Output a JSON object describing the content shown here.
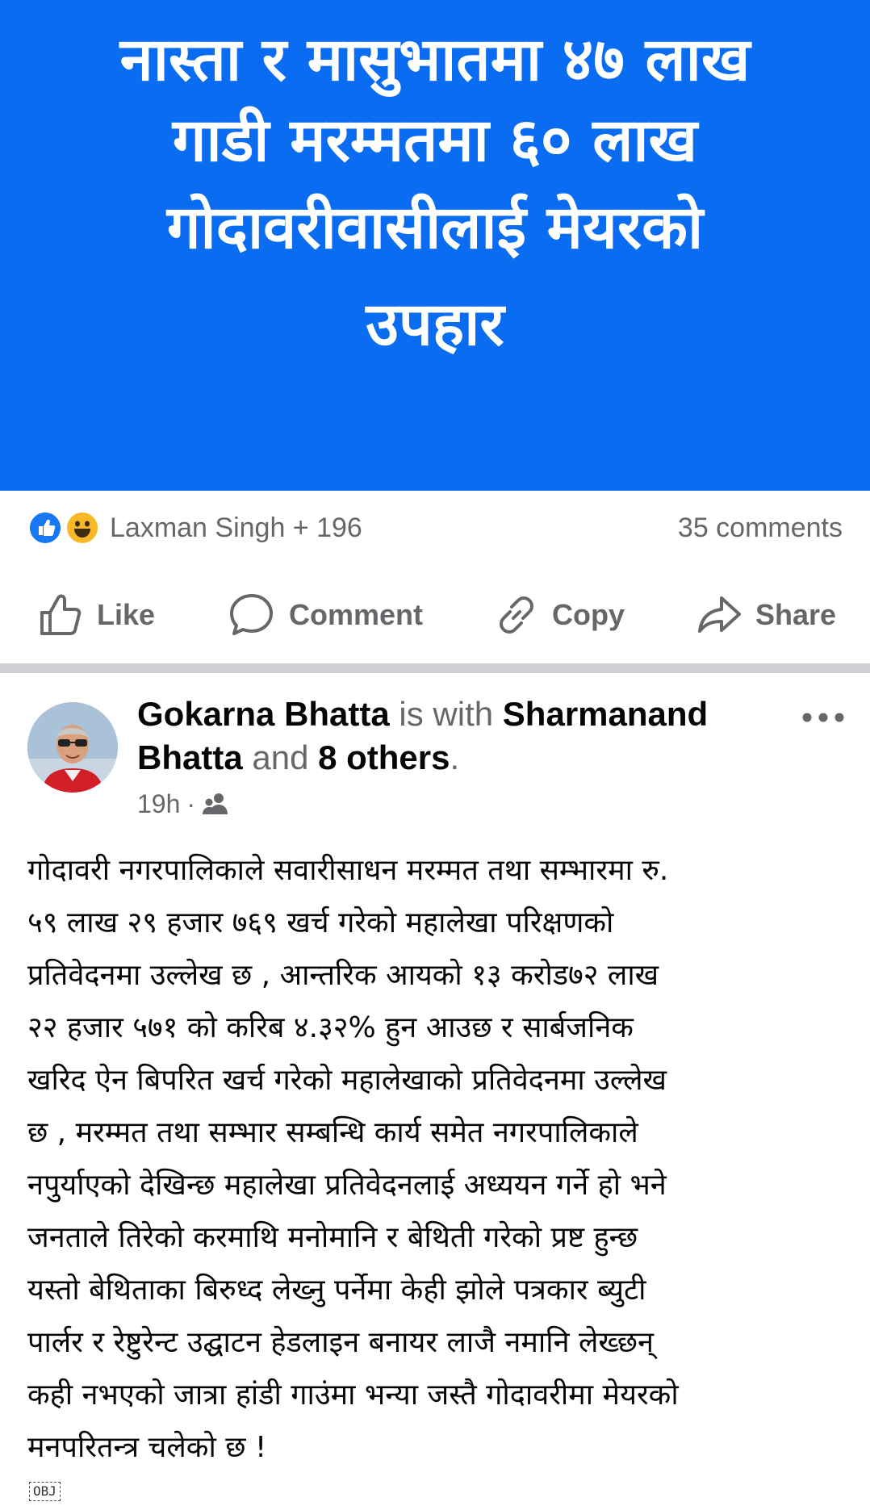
{
  "banner": {
    "lines": [
      "नास्ता र मासुभातमा ४७ लाख",
      "गाडी मरम्मतमा ६० लाख",
      "गोदावरीवासीलाई मेयरको",
      "उपहार"
    ],
    "background_color": "#0a6cf1"
  },
  "reactions": {
    "icons": [
      "like-reaction-icon",
      "haha-reaction-icon"
    ],
    "summary": "Laxman Singh + 196",
    "comments": "35 comments"
  },
  "actions": {
    "like": "Like",
    "comment": "Comment",
    "copy": "Copy",
    "share": "Share"
  },
  "post": {
    "author": "Gokarna Bhatta",
    "is_with": "is with",
    "tagged": "Sharmanand Bhatta",
    "and": "and",
    "others": "8 others",
    "period": ".",
    "time": "19h",
    "dot": "·",
    "audience_icon": "friends-icon",
    "body_lines": [
      "गोदावरी नगरपालिकाले सवारीसाधन मरम्मत तथा सम्भारमा रु.",
      "५९ लाख २९ हजार ७६९ खर्च गरेको महालेखा परिक्षणको",
      "प्रतिवेदनमा उल्लेख छ , आन्तरिक आयको १३ करोड७२ लाख",
      "२२ हजार ५७१ को करिब ४.३२%  हुन आउछ र सार्बजनिक",
      "खरिद ऐन बिपरित खर्च गरेको महालेखाको प्रतिवेदनमा उल्लेख",
      "छ , मरम्मत तथा सम्भार सम्बन्धि कार्य समेत नगरपालिकाले",
      "नपुर्याएको देखिन्छ महालेखा प्रतिवेदनलाई अध्ययन गर्ने हो भने",
      "जनताले तिरेको करमाथि मनोमानि  र बेथिती गरेको प्रष्ट हुन्छ",
      "यस्तो बेथिताका बिरुध्द लेख्नु पर्नेमा केही झोले पत्रकार ब्युटी",
      "पार्लर र रेष्टुरेन्ट उद्घाटन हेडलाइन बनायर लाजै नमानि लेख्छन्",
      "कही नभएको जात्रा हांडी गाउंमा भन्या जस्तै गोदावरीमा मेयरको",
      "मनपरितन्त्र चलेको छ !"
    ],
    "obj_marker": "OBJ"
  }
}
